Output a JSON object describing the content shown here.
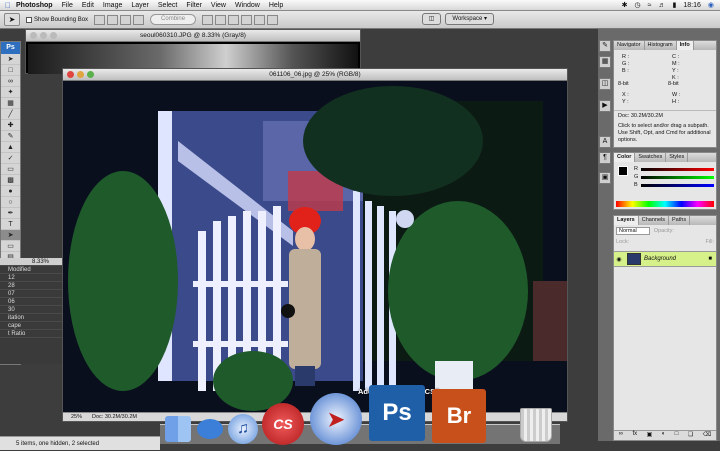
{
  "menubar": {
    "app": "Photoshop",
    "items": [
      "File",
      "Edit",
      "Image",
      "Layer",
      "Select",
      "Filter",
      "View",
      "Window",
      "Help"
    ],
    "time": "18:16"
  },
  "options": {
    "show_bounding_box": "Show Bounding Box",
    "combine": "Combine",
    "workspace": "Workspace ▾"
  },
  "doc_back": {
    "title": "seoul060310.JPG @ 8.33% (Gray/8)",
    "zoom": "8.33%"
  },
  "doc_front": {
    "title": "061106_06.jpg @ 25% (RGB/8)",
    "zoom": "25%",
    "doc_size": "Doc: 30.2M/30.2M"
  },
  "mini_panel": [
    "Modified",
    "12",
    "28",
    "07",
    "06",
    "30",
    "itation",
    "cape",
    "t Ratio"
  ],
  "toolbox": {
    "logo": "Ps"
  },
  "info_panel": {
    "tabs": [
      "Navigator",
      "Histogram",
      "Info"
    ],
    "doc": "Doc: 30.2M/30.2M",
    "help": "Click to select and/or drag a subpath. Use Shift, Opt, and Cmd for additional options.",
    "labels": [
      "R :",
      "G :",
      "B :",
      "C :",
      "M :",
      "Y :",
      "K :",
      "8-bit",
      "8-bit",
      "X :",
      "Y :",
      "W :",
      "H :"
    ]
  },
  "color_panel": {
    "tabs": [
      "Color",
      "Swatches",
      "Styles"
    ],
    "channels": [
      "R",
      "G",
      "B"
    ]
  },
  "layers_panel": {
    "tabs": [
      "Layers",
      "Channels",
      "Paths"
    ],
    "blend_mode": "Normal",
    "opacity_label": "Opacity:",
    "lock_label": "Lock:",
    "fill_label": "Fill:",
    "layer_name": "Background"
  },
  "splash": "Adobe Photoshop CS3",
  "finder_status": "5 items, one hidden, 2 selected",
  "dock": {
    "ps_label": "Ps",
    "br_label": "Br",
    "cs_label": "CS"
  },
  "colors": {
    "ps_blue": "#1f5fa8",
    "br_orange": "#c8501a",
    "layer_highlight": "#d6f08a"
  }
}
